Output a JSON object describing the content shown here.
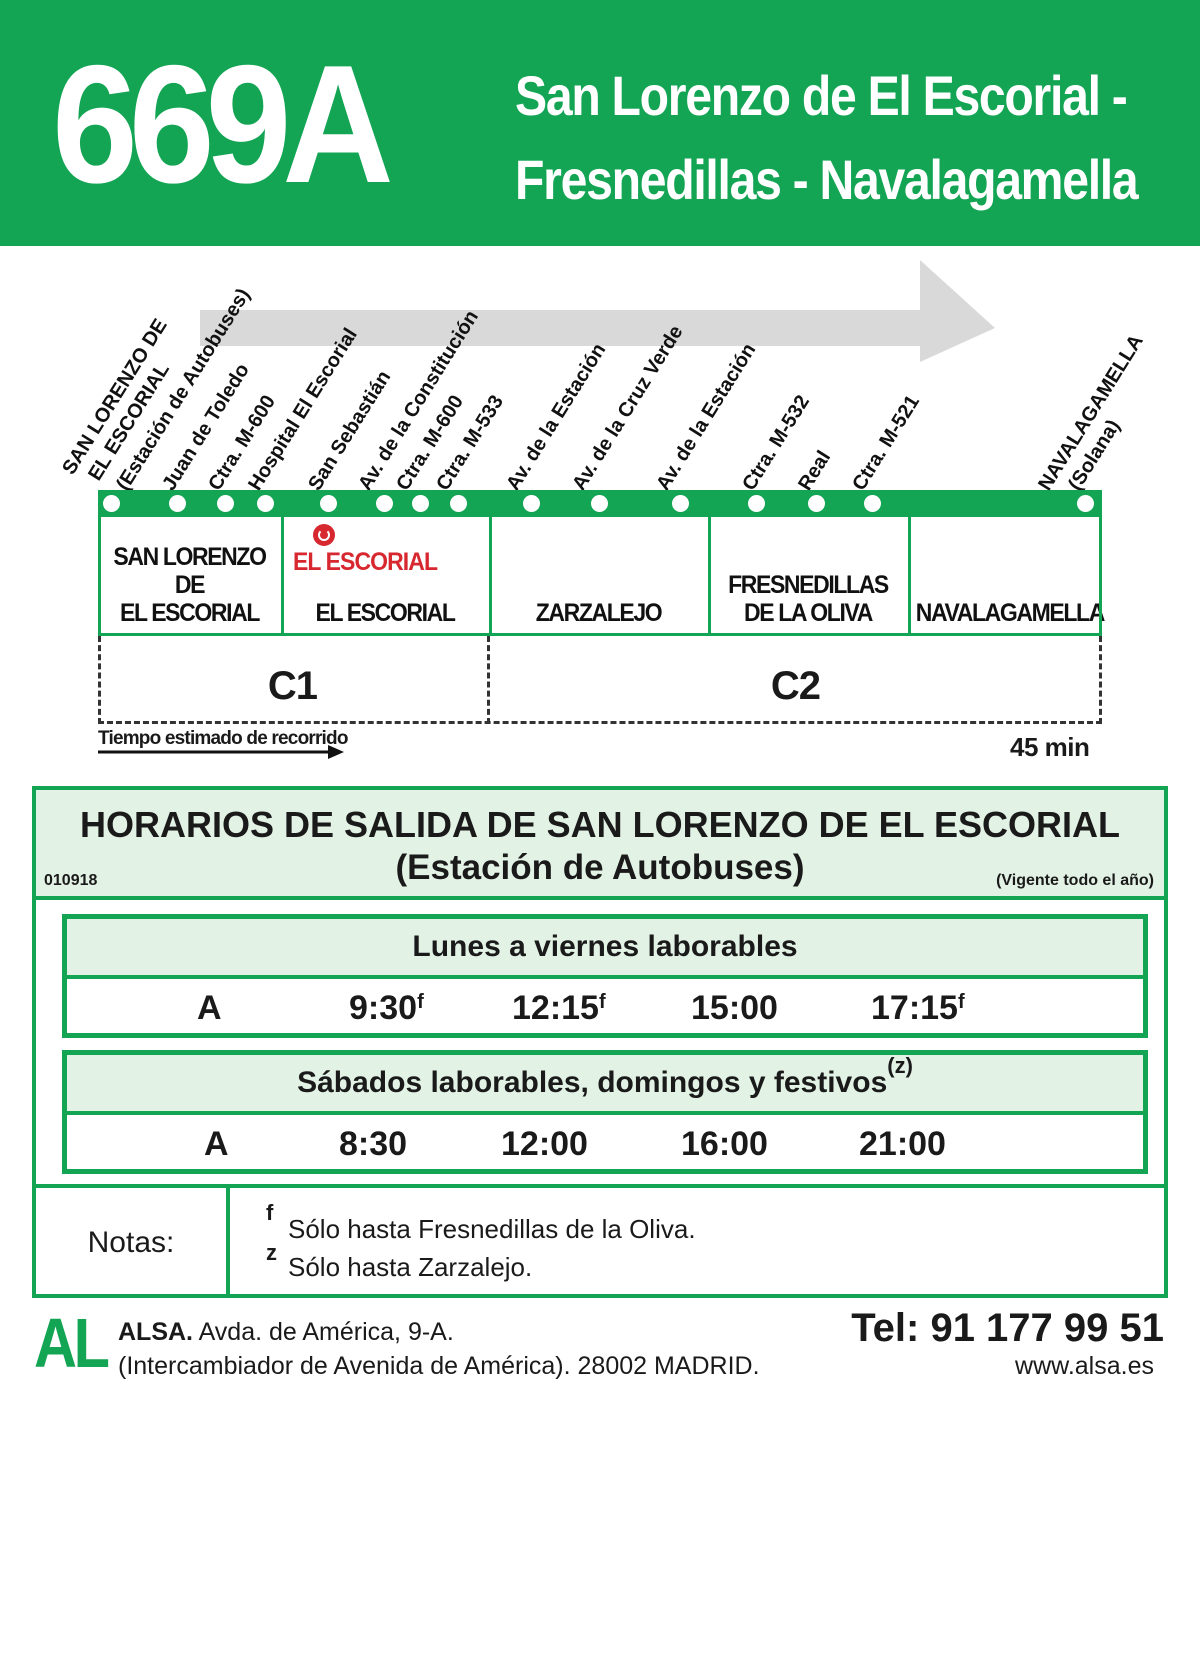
{
  "header": {
    "route": "669A",
    "line1": "San Lorenzo de El Escorial -",
    "line2": "Fresnedillas - Navalagamella",
    "color": "#13a554"
  },
  "stops": [
    "SAN LORENZO DE",
    "EL ESCORIAL",
    "(Estación de Autobuses)",
    "Juan de Toledo",
    "Ctra. M-600",
    "Hospital El Escorial",
    "San Sebastián",
    "Av. de la Constitución",
    "Ctra. M-600",
    "Ctra. M-533",
    "Av. de la Estación",
    "Av. de la Cruz Verde",
    "Av. de la Estación",
    "Ctra. M-532",
    "Real",
    "Ctra. M-521",
    "NAVALAGAMELLA",
    "(Solana)"
  ],
  "zones": {
    "san_lorenzo": [
      "SAN LORENZO DE",
      "EL ESCORIAL"
    ],
    "escorial_rail": "EL ESCORIAL",
    "escorial": "EL ESCORIAL",
    "zarzalejo": "ZARZALEJO",
    "fresnedillas": [
      "FRESNEDILLAS",
      "DE LA OLIVA"
    ],
    "navalagamella": "NAVALAGAMELLA"
  },
  "fare_zones": {
    "c1": "C1",
    "c2": "C2"
  },
  "travel_time_label": "Tiempo estimado de recorrido",
  "travel_time": "45 min",
  "schedule": {
    "title": "HORARIOS DE SALIDA DE SAN LORENZO DE EL ESCORIAL",
    "subtitle": "(Estación de Autobuses)",
    "code": "010918",
    "validity": "(Vigente todo el año)",
    "weekdays": {
      "heading": "Lunes a viernes laborables",
      "route": "A",
      "times": [
        "9:30",
        "12:15",
        "15:00",
        "17:15"
      ],
      "marks": [
        "f",
        "f",
        "",
        "f"
      ]
    },
    "weekends": {
      "heading": "Sábados laborables, domingos y festivos",
      "heading_mark": "(z)",
      "route": "A",
      "times": [
        "8:30",
        "12:00",
        "16:00",
        "21:00"
      ]
    },
    "notes": {
      "label": "Notas:",
      "items": [
        {
          "mark": "f",
          "text": "Sólo hasta Fresnedillas de la Oliva."
        },
        {
          "mark": "z",
          "text": "Sólo hasta Zarzalejo."
        }
      ]
    }
  },
  "footer": {
    "logo": "AL",
    "company": "ALSA.",
    "address1": " Avda. de América, 9-A.",
    "address2": "(Intercambiador de Avenida de América). 28002 MADRID.",
    "phone": "Tel: 91 177 99 51",
    "web": "www.alsa.es"
  }
}
